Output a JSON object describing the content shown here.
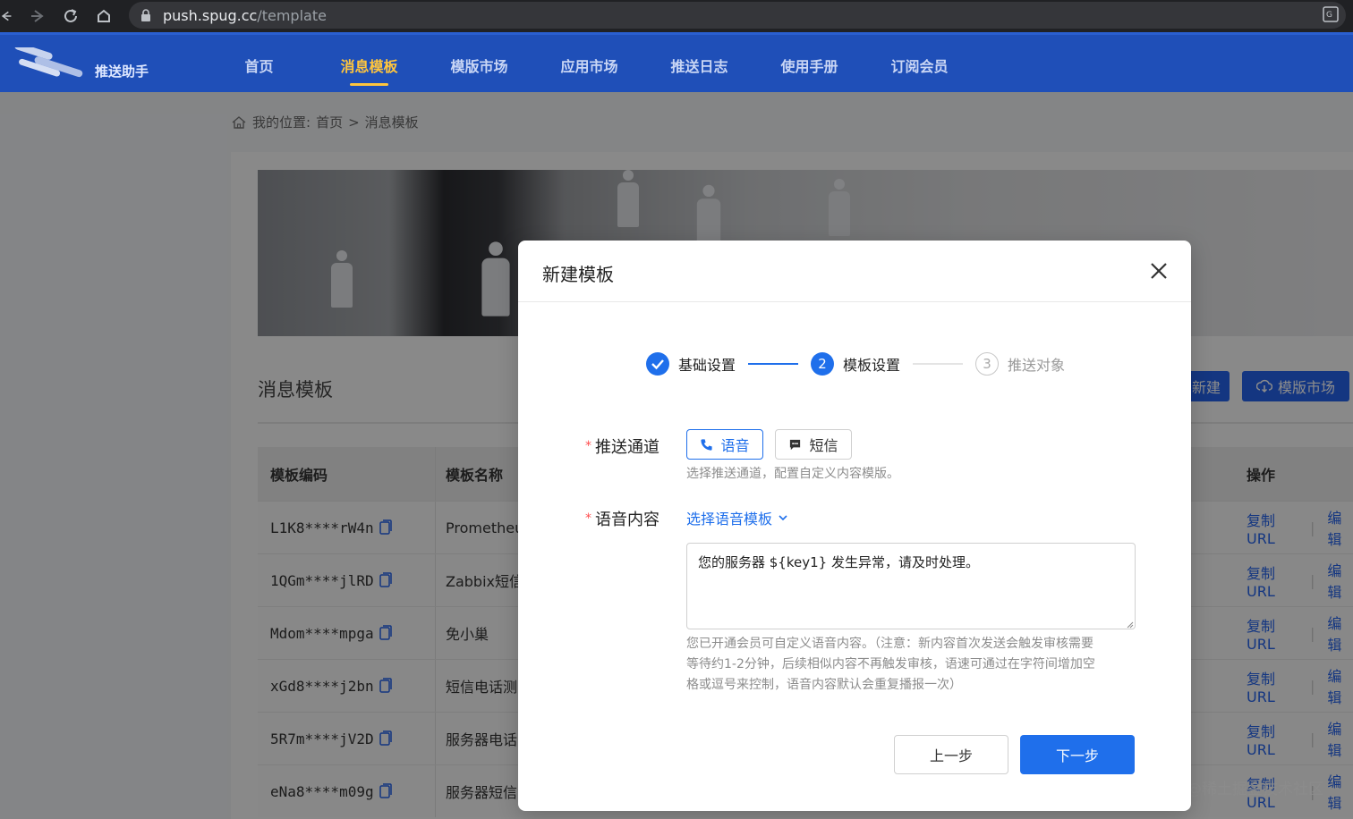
{
  "browser": {
    "url_host": "push.spug.cc",
    "url_path": "/template"
  },
  "header": {
    "brand": "推送助手",
    "menu": [
      {
        "label": "首页",
        "active": false
      },
      {
        "label": "消息模板",
        "active": true
      },
      {
        "label": "模版市场",
        "active": false
      },
      {
        "label": "应用市场",
        "active": false
      },
      {
        "label": "推送日志",
        "active": false
      },
      {
        "label": "使用手册",
        "active": false
      },
      {
        "label": "订阅会员",
        "active": false
      }
    ],
    "accent": "#ffc53d",
    "bg": "#1f4fb8"
  },
  "breadcrumb": {
    "prefix": "我的位置:",
    "home": "首页",
    "sep": ">",
    "current": "消息模板"
  },
  "page": {
    "section_title": "消息模板",
    "new_button": "新建",
    "market_button": "模版市场",
    "table": {
      "headers": {
        "code": "模板编码",
        "name": "模板名称",
        "ops": "操作"
      },
      "rows": [
        {
          "code": "L1K8****rW4n",
          "name": "Prometheu"
        },
        {
          "code": "1QGm****jlRD",
          "name": "Zabbix短信"
        },
        {
          "code": "Mdom****mpga",
          "name": "免小巢"
        },
        {
          "code": "xGd8****j2bn",
          "name": "短信电话测"
        },
        {
          "code": "5R7m****jV2D",
          "name": "服务器电话"
        },
        {
          "code": "eNa8****m09g",
          "name": "服务器短信"
        }
      ],
      "op_copy": "复制URL",
      "op_sep": "|",
      "op_edit": "编辑"
    }
  },
  "modal": {
    "title": "新建模板",
    "steps": [
      {
        "num": "1",
        "label": "基础设置",
        "status": "done"
      },
      {
        "num": "2",
        "label": "模板设置",
        "status": "active"
      },
      {
        "num": "3",
        "label": "推送对象",
        "status": "wait"
      }
    ],
    "channel": {
      "label": "推送通道",
      "required_mark": "*",
      "options": [
        {
          "label": "语音",
          "selected": true,
          "icon": "phone-icon"
        },
        {
          "label": "短信",
          "selected": false,
          "icon": "message-icon"
        }
      ],
      "hint": "选择推送通道，配置自定义内容模版。"
    },
    "voice": {
      "label": "语音内容",
      "required_mark": "*",
      "select_link": "选择语音模板",
      "content": "您的服务器 ${key1} 发生异常，请及时处理。",
      "hint_lines": [
        "您已开通会员可自定义语音内容。（注意：新内容首次发送会触发审核需要",
        "等待约1-2分钟，后续相似内容不再触发审核，语速可通过在字符间增加空",
        "格或逗号来控制，语音内容默认会重复播报一次）"
      ]
    },
    "prev_button": "上一步",
    "next_button": "下一步",
    "primary_color": "#1f6feb"
  },
  "watermark": "@稀土掘金技术社区"
}
